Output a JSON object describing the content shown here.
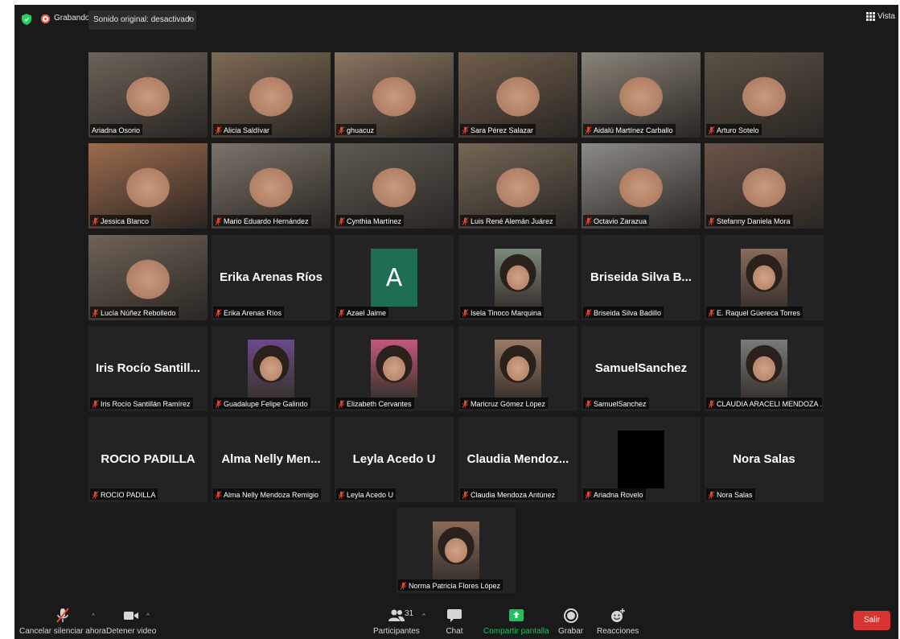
{
  "topbar": {
    "recording_label": "Grabando",
    "original_sound": "Sonido original: desactivado",
    "view_label": "Vista"
  },
  "participants": [
    {
      "name": "Ariadna Osorio",
      "muted": false,
      "active": true,
      "video": true,
      "bg": "#6d6258"
    },
    {
      "name": "Alicia Saldívar",
      "muted": true,
      "video": true,
      "bg": "#7d6a56"
    },
    {
      "name": "ghuacuz",
      "muted": true,
      "video": true,
      "bg": "#8a7562"
    },
    {
      "name": "Sara Pérez Salazar",
      "muted": true,
      "video": true,
      "bg": "#6f5d4c"
    },
    {
      "name": "Aidalú Martínez Carballo",
      "muted": true,
      "video": true,
      "bg": "#8a8378"
    },
    {
      "name": "Arturo Sotelo",
      "muted": true,
      "video": true,
      "bg": "#5b5044"
    },
    {
      "name": "Jessica Blanco",
      "muted": true,
      "video": true,
      "bg": "#9c6b4c"
    },
    {
      "name": "Mario Eduardo Hernández",
      "muted": true,
      "video": true,
      "bg": "#7c746a"
    },
    {
      "name": "Cynthia Martínez",
      "muted": true,
      "video": true,
      "bg": "#5e5a52"
    },
    {
      "name": "Luis René Alemán Juárez",
      "muted": true,
      "video": true,
      "bg": "#736656"
    },
    {
      "name": "Octavio Zarazua",
      "muted": true,
      "video": true,
      "bg": "#8d8b86"
    },
    {
      "name": "Stefanny Daniela Mora",
      "muted": true,
      "video": true,
      "bg": "#6a5548"
    },
    {
      "name": "Lucía Núñez Rebolledo",
      "muted": true,
      "video": true,
      "bg": "#6e6258"
    },
    {
      "name": "Erika Arenas Ríos",
      "display": "Erika Arenas Ríos",
      "muted": true,
      "video": false
    },
    {
      "name": "Azael Jaime",
      "muted": true,
      "video": false,
      "avatar_letter": "A"
    },
    {
      "name": "Isela Tinoco Marquina",
      "muted": true,
      "video": false,
      "photo_bg": "#7b8a7a"
    },
    {
      "name": "Briseida Silva Badillo",
      "display": "Briseida Silva B...",
      "muted": true,
      "video": false
    },
    {
      "name": "E. Raquel Güereca Torres",
      "muted": true,
      "video": false,
      "photo_bg": "#8a6b5a"
    },
    {
      "name": "Iris Rocío Santillán Ramírez",
      "display": "Iris Rocío Santill...",
      "muted": true,
      "video": false
    },
    {
      "name": "Guadalupe Felipe Galindo",
      "muted": true,
      "video": false,
      "photo_bg": "#6a4a8a"
    },
    {
      "name": "Elizabeth Cervantes",
      "muted": true,
      "video": false,
      "photo_bg": "#c4587a"
    },
    {
      "name": "Maricruz Gómez López",
      "muted": true,
      "video": false,
      "photo_bg": "#9a7a66"
    },
    {
      "name": "SamuelSanchez",
      "display": "SamuelSanchez",
      "muted": true,
      "video": false
    },
    {
      "name": "CLAUDIA ARACELI MENDOZA ...",
      "muted": true,
      "video": false,
      "photo_bg": "#7a7a78"
    },
    {
      "name": "ROCIO PADILLA",
      "display": "ROCIO PADILLA",
      "muted": true,
      "video": false
    },
    {
      "name": "Alma Nelly Mendoza Remigio",
      "display": "Alma Nelly Men...",
      "muted": true,
      "video": false
    },
    {
      "name": "Leyla Acedo U",
      "display": "Leyla Acedo U",
      "muted": true,
      "video": false
    },
    {
      "name": "Claudia Mendoza Antúnez",
      "display": "Claudia Mendoz...",
      "muted": true,
      "video": false
    },
    {
      "name": "Ariadna Rovelo",
      "muted": true,
      "video": false,
      "black_thumb": true
    },
    {
      "name": "Nora Salas",
      "display": "Nora Salas",
      "muted": true,
      "video": false
    },
    {
      "name": "Norma Patricia Flores López",
      "muted": true,
      "video": false,
      "photo_bg": "#8a6a58"
    }
  ],
  "toolbar": {
    "mute": "Cancelar silenciar ahora",
    "video": "Detener video",
    "participants": "Participantes",
    "participant_count": "31",
    "chat": "Chat",
    "share": "Compartir pantalla",
    "record": "Grabar",
    "reactions": "Reacciones",
    "leave": "Salir"
  },
  "colors": {
    "background": "#1a1a1a",
    "tile": "#232323",
    "active_border": "#d7e56a",
    "muted_red": "#e8452c",
    "share_green": "#1fbf5c",
    "leave_red": "#d93434"
  }
}
